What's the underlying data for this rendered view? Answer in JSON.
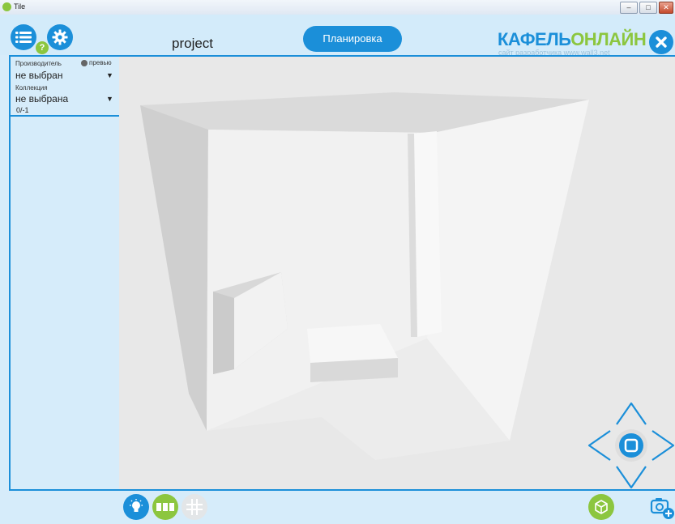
{
  "window": {
    "title": "Tile",
    "buttons": [
      "minimize",
      "maximize",
      "close"
    ]
  },
  "header": {
    "project_name": "project",
    "mode_button": "Планировка",
    "brand_part1": "КАФЕЛЬ",
    "brand_part2": "ОНЛАЙН",
    "brand_subtitle": "сайт разработчика www.wall3.net",
    "help_badge": "?"
  },
  "filters": {
    "manufacturer_label": "Производитель",
    "preview_label": "превью",
    "manufacturer_value": "не выбран",
    "collection_label": "Коллекция",
    "collection_value": "не выбрана",
    "count": "0/-1"
  },
  "icons": {
    "menu": "list-menu-icon",
    "settings": "gear-icon",
    "close": "close-icon",
    "light": "lightbulb-icon",
    "tiles": "tile-layout-icon",
    "grid": "grid-icon",
    "view3d": "cube-icon",
    "screenshot": "camera-add-icon",
    "navigation": "direction-pad-icon"
  },
  "colors": {
    "accent": "#1b8fd9",
    "brand_green": "#8cc63f",
    "panel": "#d6ecfa"
  }
}
